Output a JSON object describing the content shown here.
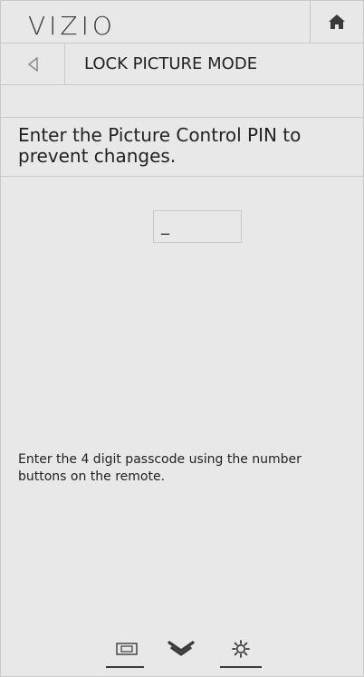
{
  "header": {
    "logo_text": "VIZIO",
    "home_icon": "home-icon"
  },
  "subheader": {
    "back_icon": "back-arrow-icon",
    "title": "LOCK PICTURE MODE"
  },
  "instruction": {
    "text": "Enter the Picture Control PIN to prevent changes."
  },
  "pin": {
    "value": "_"
  },
  "help": {
    "text": "Enter the 4 digit passcode using the number buttons on the remote."
  },
  "bottom_bar": {
    "icons": [
      "input-icon",
      "chevron-down-icon",
      "settings-icon"
    ]
  },
  "colors": {
    "background": "#e8e8e8",
    "border": "#c8c8c8",
    "text": "#222222",
    "icon": "#3a3a3a"
  }
}
